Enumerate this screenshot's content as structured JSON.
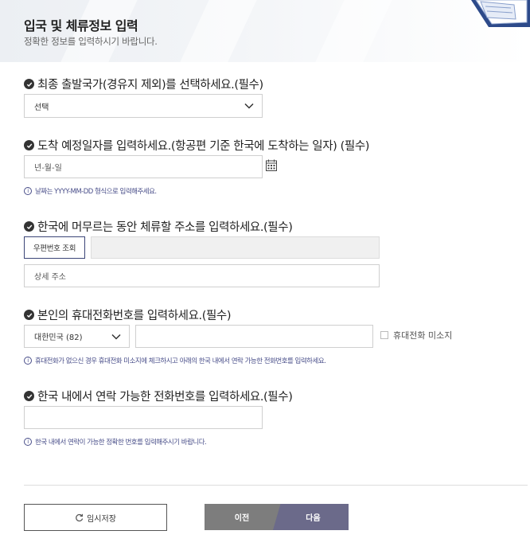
{
  "header": {
    "title": "입국 및 체류정보 입력",
    "subtitle": "정확한 정보를 입력하시기 바랍니다."
  },
  "q1": {
    "label": "최종 출발국가(경유지 제외)를 선택하세요.(필수)",
    "selected": "선택"
  },
  "q2": {
    "label": "도착 예정일자를 입력하세요.(항공편 기준 한국에 도착하는 일자) (필수)",
    "placeholder": "년-월-일",
    "note": "날짜는 YYYY-MM-DD 형식으로 입력해주세요."
  },
  "q3": {
    "label": "한국에 머무르는 동안 체류할 주소를 입력하세요.(필수)",
    "postcode_button": "우편번호 조회",
    "address_value": "",
    "detail_placeholder": "상세 주소"
  },
  "q4": {
    "label": "본인의 휴대전화번호를 입력하세요.(필수)",
    "country_selected": "대한민국 (82)",
    "phone_value": "",
    "no_phone_label": "휴대전화 미소지",
    "note": "휴대전화가 없으신 경우 휴대전화 미소지에 체크하시고 아래의 한국 내에서 연락 가능한 전화번호를 입력하세요."
  },
  "q5": {
    "label": "한국 내에서 연락 가능한 전화번호를 입력하세요.(필수)",
    "phone_value": "",
    "note": "한국 내에서 연락이 가능한 정확한 번호를 입력해주시기 바랍니다."
  },
  "actions": {
    "save_label": "임시저장",
    "prev_label": "이전",
    "next_label": "다음"
  },
  "colors": {
    "accent": "#3b4577",
    "note": "#4a4f8a",
    "prev_button": "#7d7d7d",
    "next_button": "#6b6a8a"
  }
}
